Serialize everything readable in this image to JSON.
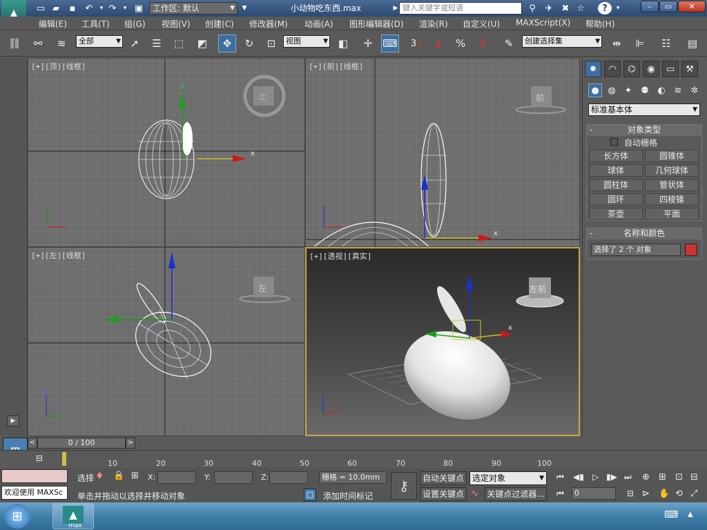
{
  "titlebar": {
    "workspace_label": "工作区: 默认",
    "doc_title": "小动物吃东西.max",
    "search_placeholder": "键入关键字或短语",
    "help_label": "?"
  },
  "menu": [
    "编辑(E)",
    "工具(T)",
    "组(G)",
    "视图(V)",
    "创建(C)",
    "修改器(M)",
    "动画(A)",
    "图形编辑器(D)",
    "渲染(R)",
    "自定义(U)",
    "MAXScript(X)",
    "帮助(H)"
  ],
  "toolbar": {
    "selection_filter": "全部",
    "reference_coord": "视图",
    "named_selection": "创建选择集",
    "snap_label": "3",
    "percent_label": "%"
  },
  "viewports": {
    "top": {
      "label": "[+][顶][线框]",
      "cube_label": "上"
    },
    "front": {
      "label": "[+][前][线框]",
      "cube_label": "前"
    },
    "left": {
      "label": "[+][左][线框]",
      "cube_label": "左"
    },
    "persp": {
      "label": "[+][透视][真实]",
      "cube_label": "左前"
    }
  },
  "axis_x": "x",
  "axis_y": "y",
  "axis_z": "z",
  "command_panel": {
    "category": "标准基本体",
    "object_type_title": "对象类型",
    "autogrid_label": "自动栅格",
    "object_buttons": [
      "长方体",
      "圆锥体",
      "球体",
      "几何球体",
      "圆柱体",
      "管状体",
      "圆环",
      "四棱锥",
      "茶壶",
      "平面"
    ],
    "name_color_title": "名称和颜色",
    "name_field": "选择了 2 个 对象",
    "object_color": "#cc3333"
  },
  "timeline": {
    "frame_display": "0 / 100",
    "ticks": [
      "10",
      "20",
      "30",
      "40",
      "50",
      "60",
      "70",
      "80",
      "90",
      "100"
    ]
  },
  "status": {
    "welcome": "欢迎使用 MAXSc",
    "selection_label": "选择",
    "x_label": "X:",
    "y_label": "Y:",
    "z_label": "Z:",
    "grid_text": "栅格 = 10.0mm",
    "prompt": "单击并拖动以选择并移动对象",
    "add_time_tag": "添加时间标记",
    "auto_key": "自动关键点",
    "set_key": "设置关键点",
    "key_mode_select": "选定对象",
    "key_filters": "关键点过滤器...",
    "frame_field": "0"
  },
  "taskbar": {
    "app_label": "max"
  },
  "colors": {
    "accent_yellow": "#c9a84a",
    "axis_red": "#d01818",
    "axis_green": "#18a018",
    "axis_blue": "#1a2fd0"
  }
}
